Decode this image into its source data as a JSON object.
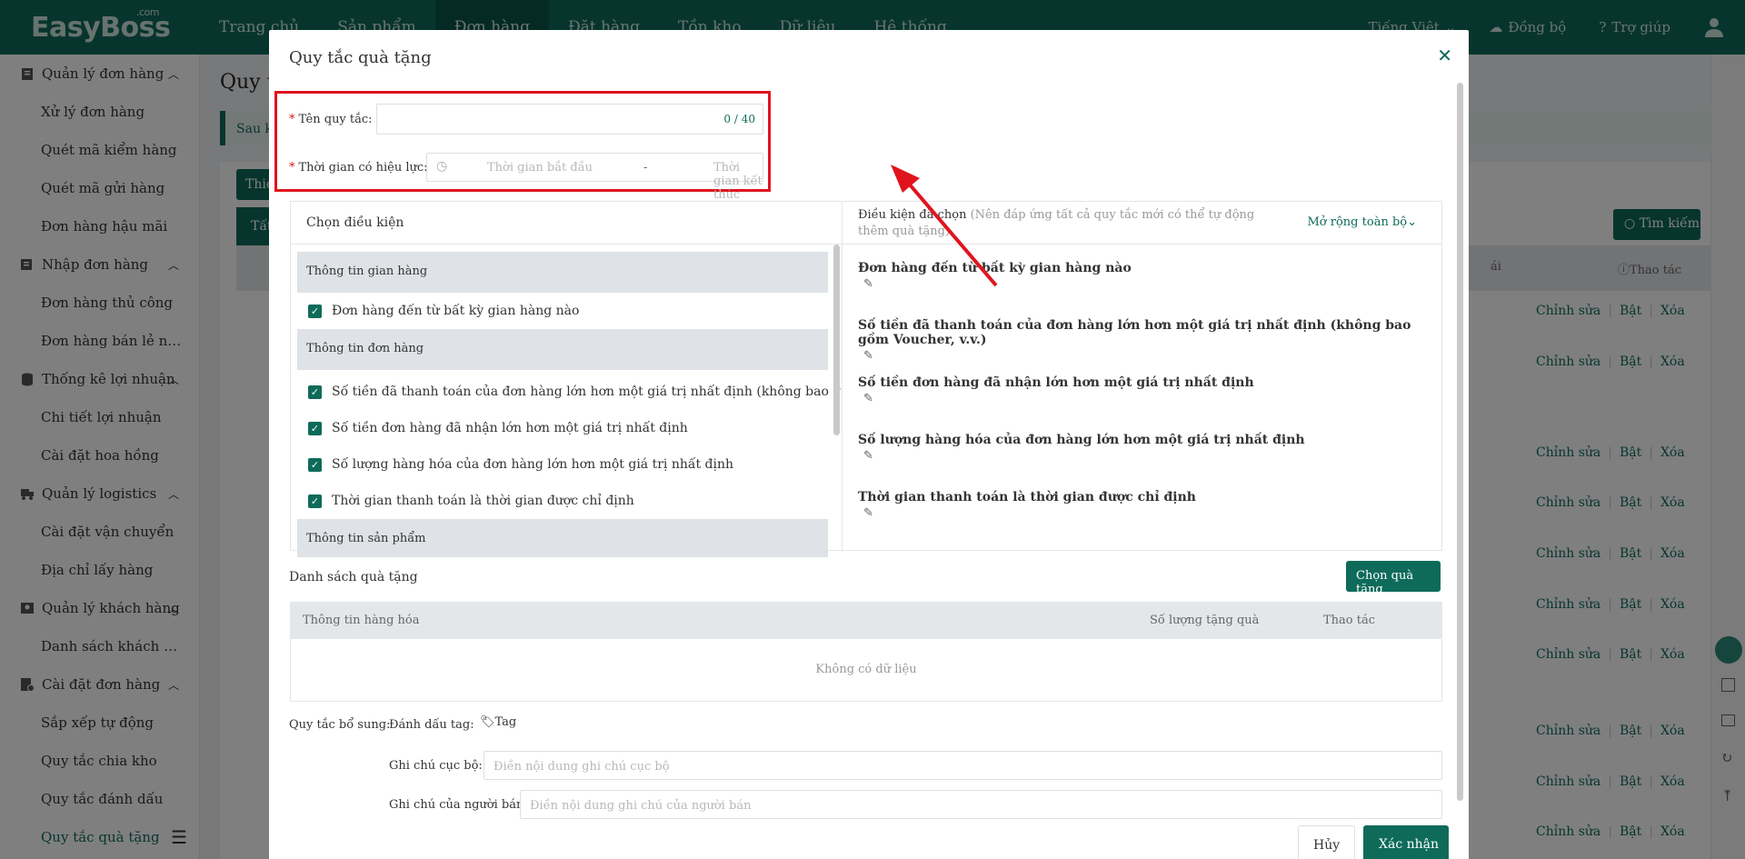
{
  "topbar": {
    "logo": "EasyBoss",
    "logo_suffix": ".com",
    "nav": [
      "Trang chủ",
      "Sản phẩm",
      "Đơn hàng",
      "Đặt hàng",
      "Tồn kho",
      "Dữ liệu",
      "Hệ thống"
    ],
    "active_nav": "Đơn hàng",
    "language": "Tiếng Việt",
    "sync": "Đồng bộ",
    "help": "Trợ giúp"
  },
  "sidebar": {
    "groups": [
      {
        "label": "Quản lý đơn hàng",
        "icon": "clipboard-icon",
        "items": [
          "Xử lý đơn hàng",
          "Quét mã kiểm hàng",
          "Quét mã gửi hàng",
          "Đơn hàng hậu mãi"
        ]
      },
      {
        "label": "Nhập đơn hàng",
        "icon": "import-icon",
        "items": [
          "Đơn hàng thủ công",
          "Đơn hàng bán lẻ ngoại..."
        ]
      },
      {
        "label": "Thống kê lợi nhuận",
        "icon": "database-icon",
        "items": [
          "Chi tiết lợi nhuận",
          "Cài đặt hoa hồng"
        ]
      },
      {
        "label": "Quản lý logistics",
        "icon": "truck-icon",
        "items": [
          "Cài đặt vận chuyển",
          "Địa chỉ lấy hàng"
        ]
      },
      {
        "label": "Quản lý khách hàng",
        "icon": "contacts-icon",
        "items": [
          "Danh sách khách hàng"
        ]
      },
      {
        "label": "Cài đặt đơn hàng",
        "icon": "settings-doc-icon",
        "items": [
          "Sắp xếp tự động",
          "Quy tắc chia kho",
          "Quy tắc đánh dấu",
          "Quy tắc quà tặng"
        ]
      }
    ],
    "active_item": "Quy tắc quà tặng"
  },
  "background": {
    "page_title": "Quy t",
    "banner_text": "Sau k",
    "add_button": "Thiế",
    "tab_all": "Tất",
    "search_button": "Tìm kiếm",
    "col_status": "ái",
    "col_actions": "Thao tác",
    "row_actions": {
      "edit": "Chỉnh sửa",
      "enable": "Bật",
      "delete": "Xóa"
    }
  },
  "modal": {
    "title": "Quy tắc quà tặng",
    "rule_name_label": "Tên quy tắc:",
    "rule_name_value": "",
    "rule_name_counter": "0 / 40",
    "validity_label": "Thời gian có hiệu lực:",
    "start_placeholder": "Thời gian bắt đầu",
    "range_separator": "-",
    "end_placeholder": "Thời gian kết thúc",
    "conditions": {
      "left_title": "Chọn điều kiện",
      "sections": [
        {
          "title": "Thông tin gian hàng",
          "items": [
            "Đơn hàng đến từ bất kỳ gian hàng nào"
          ]
        },
        {
          "title": "Thông tin đơn hàng",
          "items": [
            "Số tiền đã thanh toán của đơn hàng lớn hơn một giá trị nhất định (không bao gồm V...",
            "Số tiền đơn hàng đã nhận lớn hơn một giá trị nhất định",
            "Số lượng hàng hóa của đơn hàng lớn hơn một giá trị nhất định",
            "Thời gian thanh toán là thời gian được chỉ định"
          ]
        },
        {
          "title": "Thông tin sản phẩm",
          "items": []
        }
      ],
      "right_title": "Điều kiện đã chọn",
      "right_note": "(Nên đáp ứng tất cả quy tắc mới có thể tự động thêm quà tặng)",
      "expand_all": "Mở rộng toàn bộ",
      "selected": [
        "Đơn hàng đến từ bất kỳ gian hàng nào",
        "Số tiền đã thanh toán của đơn hàng lớn hơn một giá trị nhất định (không bao gồm Voucher, v.v.)",
        "Số tiền đơn hàng đã nhận lớn hơn một giá trị nhất định",
        "Số lượng hàng hóa của đơn hàng lớn hơn một giá trị nhất định",
        "Thời gian thanh toán là thời gian được chỉ định"
      ]
    },
    "gift_list_title": "Danh sách quà tặng",
    "choose_gift_button": "Chọn quà tặng",
    "gift_table": {
      "col_info": "Thông tin hàng hóa",
      "col_qty": "Số lượng tặng quà",
      "col_action": "Thao tác",
      "empty": "Không có dữ liệu"
    },
    "extra_rules_label": "Quy tắc bổ sung:",
    "mark_tag_label": "Đánh dấu tag:",
    "tag_button": "Tag",
    "local_note_label": "Ghi chú cục bộ:",
    "local_note_placeholder": "Điền nội dung ghi chú cục bộ",
    "seller_note_label": "Ghi chú của người bán:",
    "seller_note_placeholder": "Điền nội dung ghi chú của người bán",
    "cancel_button": "Hủy",
    "confirm_button": "Xác nhận"
  },
  "colors": {
    "brand": "#0e6b5a",
    "highlight": "#e0141e"
  }
}
